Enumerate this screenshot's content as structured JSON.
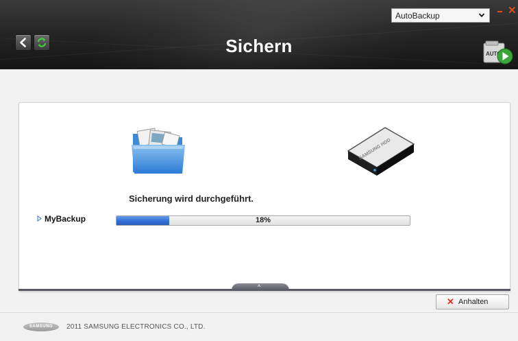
{
  "header": {
    "title": "Sichern",
    "dropdown_selected": "AutoBackup",
    "back_icon": "back-arrow-icon",
    "refresh_icon": "refresh-icon",
    "auto_badge": "AUTO"
  },
  "main": {
    "status_text": "Sicherung wird durchgeführt.",
    "job": {
      "name": "MyBackup",
      "progress_percent": 18,
      "progress_label": "18%"
    },
    "source_icon": "folder-icon",
    "target_icon": "external-hdd-icon",
    "hdd_label": "SAMSUNG HDD"
  },
  "actions": {
    "stop_label": "Anhalten"
  },
  "footer": {
    "brand": "SAMSUNG",
    "copyright": "2011 SAMSUNG ELECTRONICS CO., LTD."
  },
  "colors": {
    "header_bg": "#1c1c1c",
    "progress_fill": "#2f6fd6",
    "close_accent": "#e14b1a",
    "stop_icon": "#d8331a",
    "refresh_green": "#3fd13c"
  }
}
